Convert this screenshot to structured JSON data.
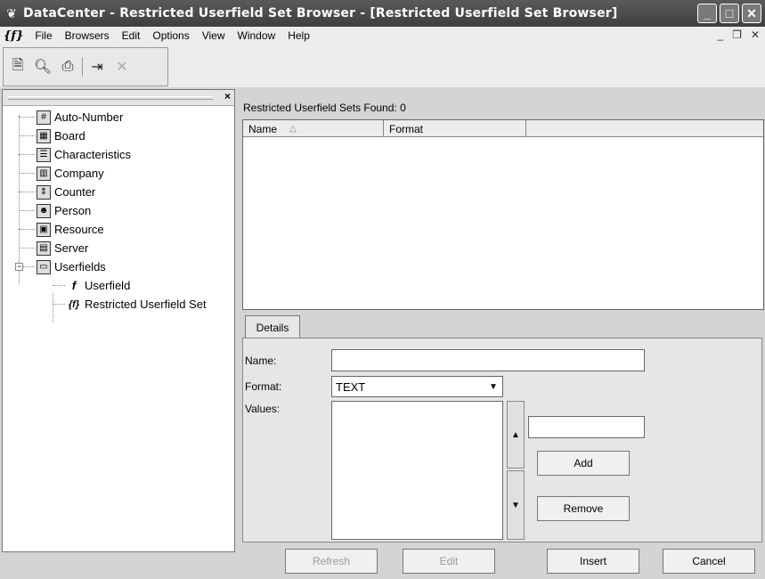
{
  "window": {
    "title": "DataCenter - Restricted Userfield Set Browser - [Restricted Userfield Set Browser]",
    "app_icon": "datacenter-icon"
  },
  "menubar": {
    "logo": "{f}",
    "items": [
      "File",
      "Browsers",
      "Edit",
      "Options",
      "View",
      "Window",
      "Help"
    ]
  },
  "toolbar": {
    "icons": [
      "new-icon",
      "search-icon",
      "print-icon",
      "insert-icon",
      "delete-icon"
    ]
  },
  "tree": {
    "items": [
      {
        "label": "Auto-Number",
        "icon": "auto-number-icon"
      },
      {
        "label": "Board",
        "icon": "board-icon"
      },
      {
        "label": "Characteristics",
        "icon": "characteristics-icon"
      },
      {
        "label": "Company",
        "icon": "company-icon"
      },
      {
        "label": "Counter",
        "icon": "counter-icon"
      },
      {
        "label": "Person",
        "icon": "person-icon"
      },
      {
        "label": "Resource",
        "icon": "resource-icon"
      },
      {
        "label": "Server",
        "icon": "server-icon"
      },
      {
        "label": "Userfields",
        "icon": "folder-icon"
      },
      {
        "label": "Userfield",
        "icon": "userfield-icon"
      },
      {
        "label": "Restricted Userfield Set",
        "icon": "restricted-userfield-set-icon"
      }
    ]
  },
  "main": {
    "found_label": "Restricted Userfield Sets Found: 0",
    "columns": [
      "Name",
      "Format"
    ],
    "sort_indicator": "△"
  },
  "details": {
    "tab_label": "Details",
    "name_label": "Name:",
    "name_value": "",
    "format_label": "Format:",
    "format_value": "TEXT",
    "values_label": "Values:",
    "add_label": "Add",
    "remove_label": "Remove"
  },
  "buttons": {
    "refresh": "Refresh",
    "edit": "Edit",
    "insert": "Insert",
    "cancel": "Cancel"
  }
}
